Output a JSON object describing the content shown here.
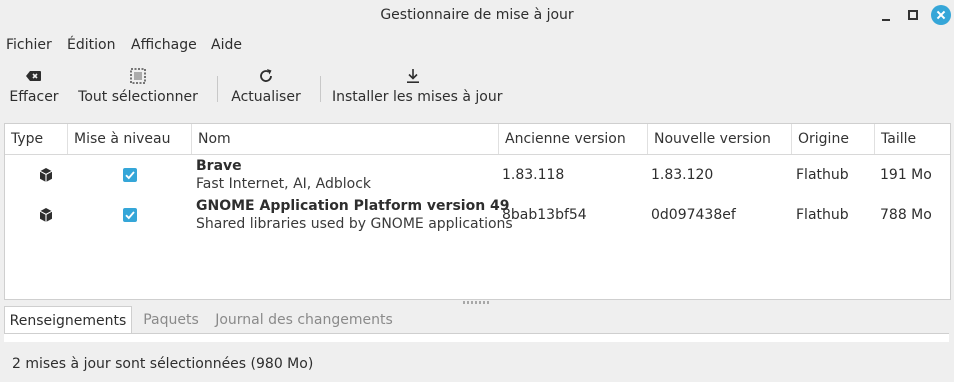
{
  "window": {
    "title": "Gestionnaire de mise à jour"
  },
  "menu": {
    "items": [
      "Fichier",
      "Édition",
      "Affichage",
      "Aide"
    ]
  },
  "toolbar": {
    "clear_label": "Effacer",
    "select_all_label": "Tout sélectionner",
    "refresh_label": "Actualiser",
    "install_label": "Installer les mises à jour"
  },
  "table": {
    "columns": [
      "Type",
      "Mise à niveau",
      "Nom",
      "Ancienne version",
      "Nouvelle version",
      "Origine",
      "Taille"
    ],
    "rows": [
      {
        "type_icon": "package-icon",
        "upgrade": true,
        "name": "Brave",
        "description": "Fast Internet, AI, Adblock",
        "old_version": "1.83.118",
        "new_version": "1.83.120",
        "origin": "Flathub",
        "size": "191 Mo"
      },
      {
        "type_icon": "package-icon",
        "upgrade": true,
        "name": "GNOME Application Platform version 49",
        "description": "Shared libraries used by GNOME applications",
        "old_version": "8bab13bf54",
        "new_version": "0d097438ef",
        "origin": "Flathub",
        "size": "788 Mo"
      }
    ]
  },
  "tabs": [
    "Renseignements",
    "Paquets",
    "Journal des changements"
  ],
  "active_tab": "Renseignements",
  "status": "2 mises à jour sont sélectionnées (980 Mo)",
  "colors": {
    "accent": "#35a6d8",
    "window_bg": "#efefef",
    "list_bg": "#ffffff"
  }
}
